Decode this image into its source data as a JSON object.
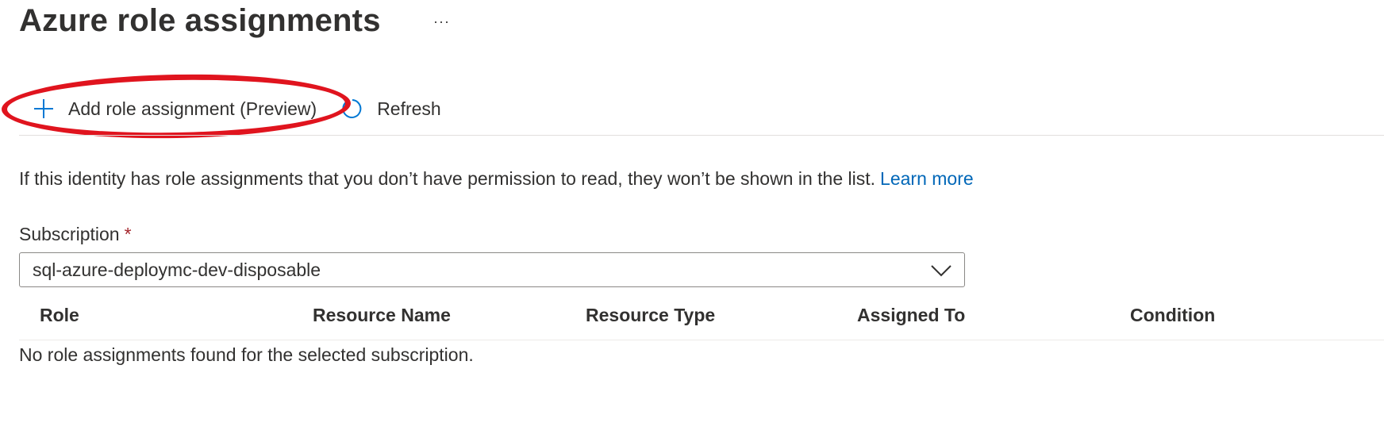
{
  "header": {
    "title": "Azure role assignments",
    "more_label": "···"
  },
  "toolbar": {
    "add_label": "Add role assignment (Preview)",
    "refresh_label": "Refresh"
  },
  "info": {
    "text": "If this identity has role assignments that you don’t have permission to read, they won’t be shown in the list.",
    "link_label": "Learn more"
  },
  "subscription": {
    "label": "Subscription",
    "required_mark": "*",
    "value": "sql-azure-deploymc-dev-disposable"
  },
  "table": {
    "columns": [
      "Role",
      "Resource Name",
      "Resource Type",
      "Assigned To",
      "Condition"
    ],
    "empty_message": "No role assignments found for the selected subscription."
  },
  "icons": {
    "add": "plus-icon",
    "refresh": "refresh-icon",
    "dropdown": "chevron-down-icon"
  },
  "colors": {
    "link": "#0067b8",
    "required": "#a4262c",
    "annotation": "#e0141e",
    "accent": "#0078d4"
  }
}
